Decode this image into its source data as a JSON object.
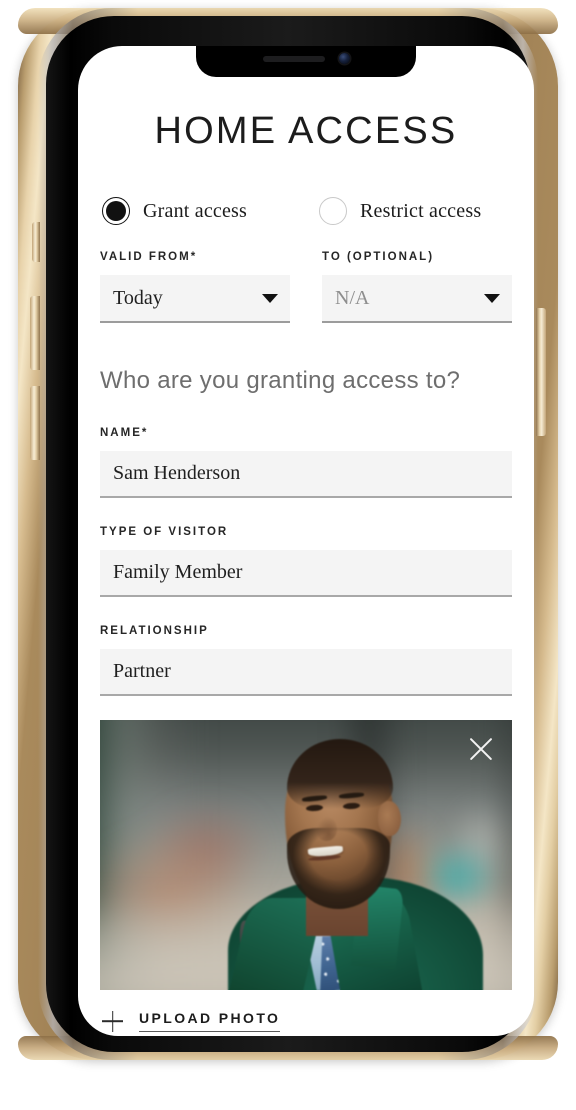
{
  "device": {
    "notch": {
      "speaker_name": "speaker-grille",
      "camera_name": "front-camera"
    },
    "buttons": {
      "silent_switch": "silent-switch",
      "volume_up": "volume-up",
      "volume_down": "volume-down",
      "power": "power-button"
    },
    "frame_color": "#c2a477",
    "bezel_color": "#0a0a0a"
  },
  "screen": {
    "title": "HOME ACCESS",
    "access_mode": {
      "options": [
        {
          "label": "Grant access",
          "selected": true
        },
        {
          "label": "Restrict access",
          "selected": false
        }
      ]
    },
    "date_fields": [
      {
        "label": "VALID FROM*",
        "value": "Today",
        "is_placeholder": false,
        "caret": "chevron-down-icon"
      },
      {
        "label": "TO (OPTIONAL)",
        "value": "N/A",
        "is_placeholder": true,
        "caret": "chevron-down-icon"
      }
    ],
    "section_heading": "Who are you granting access to?",
    "text_fields": [
      {
        "label": "NAME*",
        "value": "Sam Henderson"
      },
      {
        "label": "TYPE OF VISITOR",
        "value": "Family Member"
      },
      {
        "label": "RELATIONSHIP",
        "value": "Partner"
      }
    ],
    "photo": {
      "alt": "Smiling man in dark green jacket with blue shirt and polka-dot tie on a blurred city street",
      "remove_icon": "close-icon"
    },
    "upload": {
      "icon": "plus-icon",
      "label": "UPLOAD PHOTO"
    },
    "colors": {
      "text_primary": "#1c1c1c",
      "text_muted": "#6e6e6e",
      "field_fill": "#f4f4f4",
      "field_underline": "#a8a8a8",
      "jacket_green": "#14543f",
      "tie_blue": "#3f6490"
    }
  }
}
